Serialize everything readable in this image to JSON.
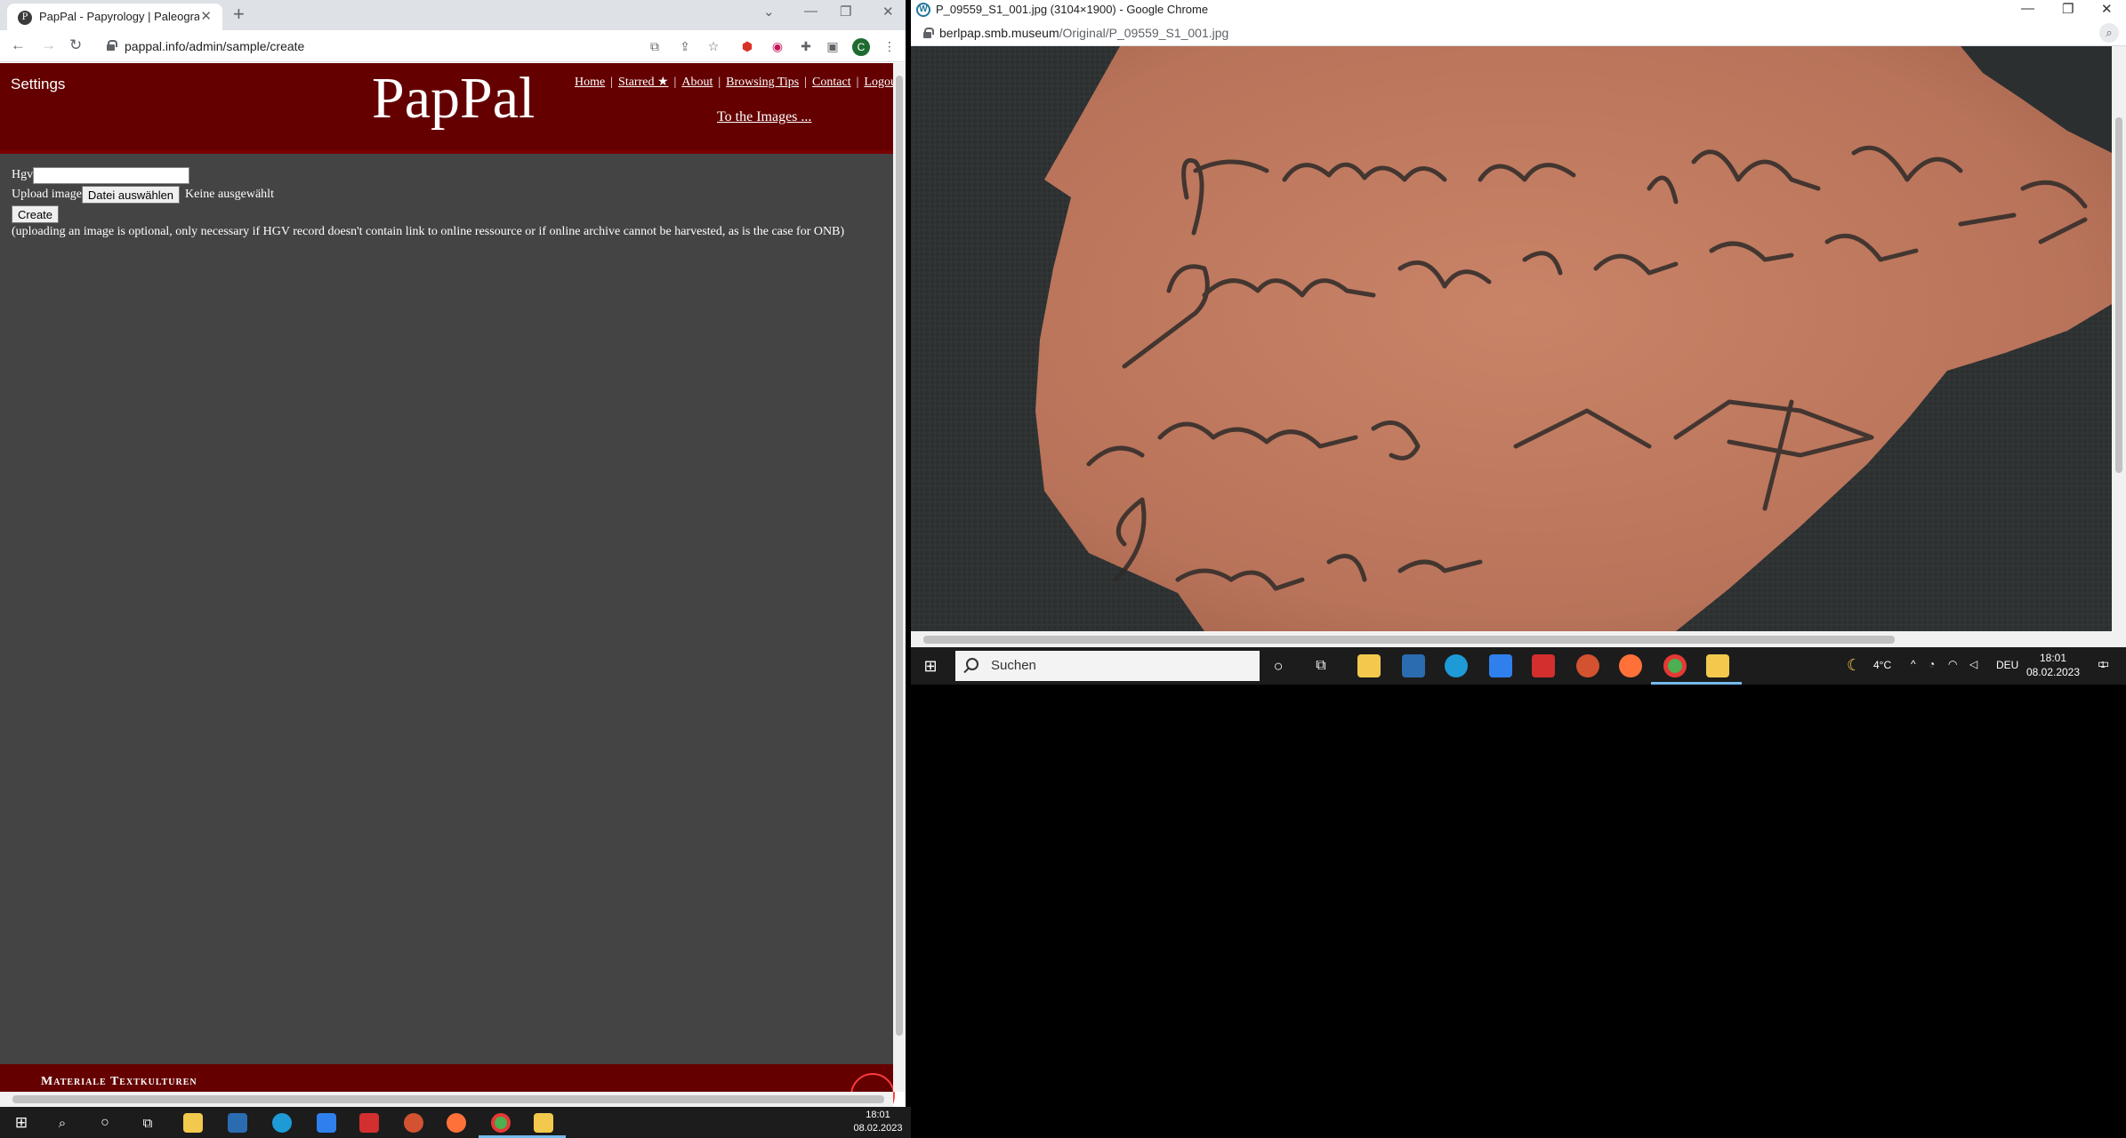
{
  "left_window": {
    "tab_title": "PapPal - Papyrology | Paleographic",
    "url": "pappal.info/admin/sample/create",
    "profile_initial": "C",
    "page": {
      "settings_label": "Settings",
      "brand": "PapPal",
      "nav": [
        "Home",
        "Starred ★",
        "About",
        "Browsing Tips",
        "Contact",
        "Logout"
      ],
      "to_images": "To the Images ...",
      "form": {
        "hgv_label": "Hgv",
        "hgv_value": "",
        "upload_label": "Upload image",
        "file_button": "Datei auswählen",
        "file_status": "Keine ausgewählt",
        "create_button": "Create",
        "note": "(uploading an image is optional, only necessary if HGV record doesn't contain link to online ressource or if online archive cannot be harvested, as is the case for ONB)"
      },
      "footer_text": "Materiale Textkulturen"
    }
  },
  "right_window": {
    "title": "P_09559_S1_001.jpg (3104×1900) - Google Chrome",
    "url_host": "berlpap.smb.museum",
    "url_path": "/Original/P_09559_S1_001.jpg"
  },
  "taskbar_right": {
    "search_placeholder": "Suchen",
    "weather": "4°C",
    "language": "DEU",
    "time": "18:01",
    "date": "08.02.2023",
    "notification_count": "1"
  },
  "taskbar_left": {
    "time": "18:01",
    "date": "08.02.2023"
  },
  "colors": {
    "header_red": "#650000",
    "page_bg": "#444444",
    "taskbar": "#1c1c1c",
    "sherd": "#c27a5e"
  }
}
